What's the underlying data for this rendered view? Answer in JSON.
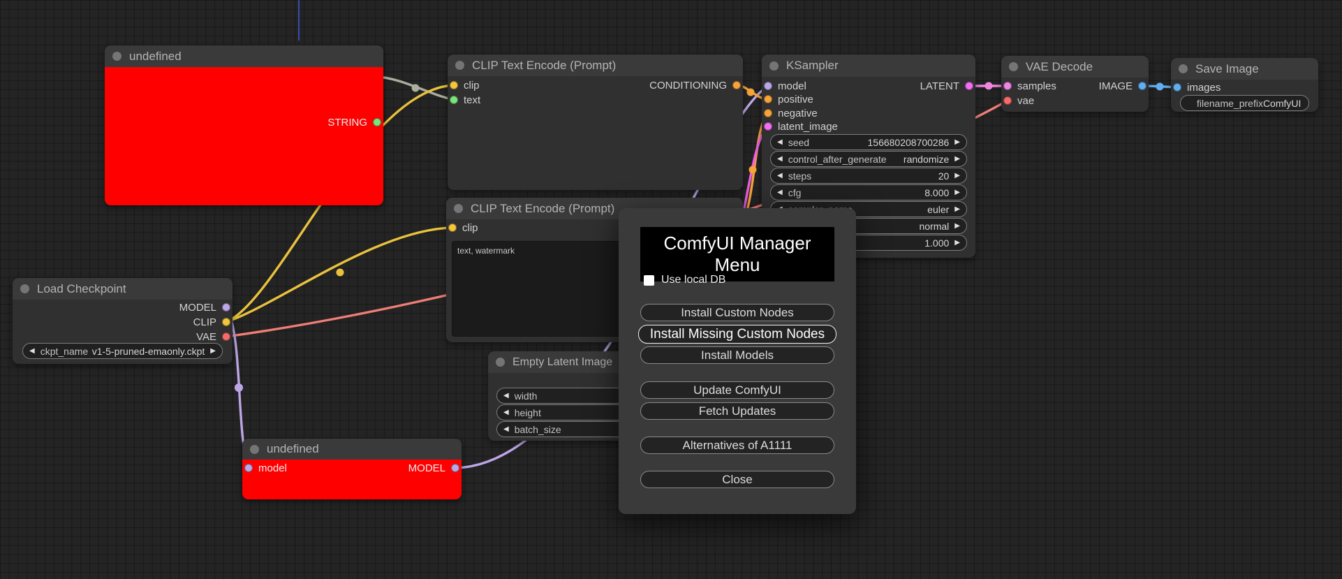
{
  "canvas": {
    "background": "#242424",
    "grid_line": "#1a1a1a",
    "origin_line_color": "#3d55c8"
  },
  "colors": {
    "error_node_body": "#ff0000",
    "model": "#bda6e6",
    "clip": "#f2c73d",
    "vae": "#f56b6b",
    "conditioning": "#f6a33c",
    "latent": "#f36ef0",
    "image": "#62aef0",
    "string": "#7be47b"
  },
  "icons": {
    "stepper_left": "◀",
    "stepper_right": "▶"
  },
  "nodes": {
    "undefined_top": {
      "title": "undefined",
      "outputs": [
        {
          "label": "STRING"
        }
      ]
    },
    "clip_text_encode_1": {
      "title": "CLIP Text Encode (Prompt)",
      "inputs": [
        {
          "label": "clip"
        },
        {
          "label": "text"
        }
      ],
      "outputs": [
        {
          "label": "CONDITIONING"
        }
      ]
    },
    "clip_text_encode_2": {
      "title": "CLIP Text Encode (Prompt)",
      "inputs": [
        {
          "label": "clip"
        }
      ],
      "text_content": "text, watermark"
    },
    "ksampler": {
      "title": "KSampler",
      "inputs": [
        {
          "label": "model"
        },
        {
          "label": "positive"
        },
        {
          "label": "negative"
        },
        {
          "label": "latent_image"
        }
      ],
      "outputs": [
        {
          "label": "LATENT"
        }
      ],
      "widgets": [
        {
          "name": "seed",
          "value": "156680208700286"
        },
        {
          "name": "control_after_generate",
          "value": "randomize"
        },
        {
          "name": "steps",
          "value": "20"
        },
        {
          "name": "cfg",
          "value": "8.000"
        },
        {
          "name": "sampler_name",
          "value": "euler"
        },
        {
          "name": "",
          "value": "normal"
        },
        {
          "name": "",
          "value": "1.000"
        }
      ]
    },
    "vae_decode": {
      "title": "VAE Decode",
      "inputs": [
        {
          "label": "samples"
        },
        {
          "label": "vae"
        }
      ],
      "outputs": [
        {
          "label": "IMAGE"
        }
      ]
    },
    "save_image": {
      "title": "Save Image",
      "inputs": [
        {
          "label": "images"
        }
      ],
      "widgets": [
        {
          "name": "filename_prefix",
          "value": "ComfyUI"
        }
      ]
    },
    "load_checkpoint": {
      "title": "Load Checkpoint",
      "outputs": [
        {
          "label": "MODEL"
        },
        {
          "label": "CLIP"
        },
        {
          "label": "VAE"
        }
      ],
      "widgets": [
        {
          "name": "ckpt_name",
          "value": "v1-5-pruned-emaonly.ckpt"
        }
      ]
    },
    "empty_latent_image": {
      "title": "Empty Latent Image",
      "widgets": [
        {
          "name": "width"
        },
        {
          "name": "height"
        },
        {
          "name": "batch_size"
        }
      ]
    },
    "undefined_bottom": {
      "title": "undefined",
      "inputs": [
        {
          "label": "model"
        }
      ],
      "outputs": [
        {
          "label": "MODEL"
        }
      ]
    }
  },
  "dialog": {
    "title": "ComfyUI Manager Menu",
    "checkbox_label": "Use local DB",
    "checkbox_checked": false,
    "buttons": [
      "Install Custom Nodes",
      "Install Missing Custom Nodes",
      "Install Models",
      "Update ComfyUI",
      "Fetch Updates",
      "Alternatives of A1111",
      "Close"
    ]
  }
}
